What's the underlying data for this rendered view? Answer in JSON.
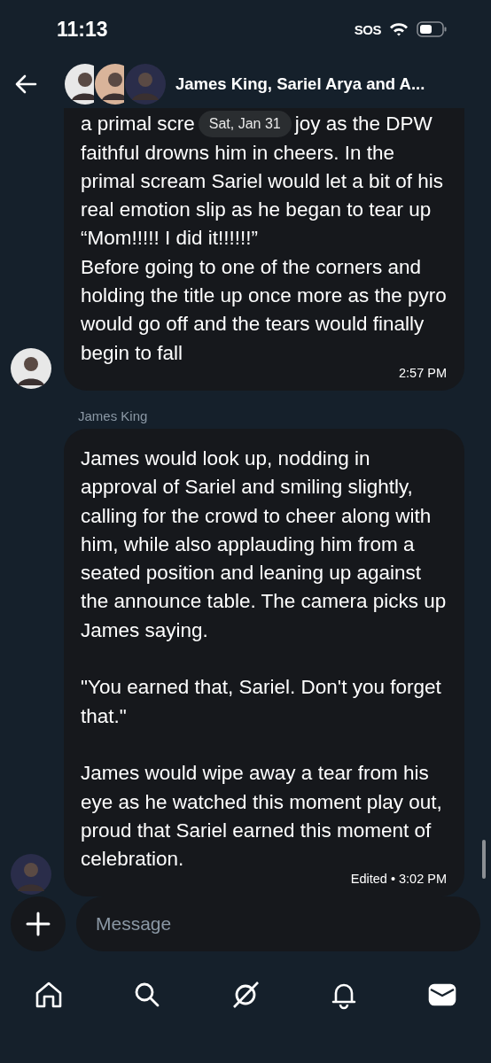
{
  "status_bar": {
    "time": "11:13",
    "sos": "SOS"
  },
  "header": {
    "title": "James King, Sariel Arya and A..."
  },
  "messages": [
    {
      "first_line": [
        "a primal scre",
        "joy as the DPW"
      ],
      "date_pill": "Sat, Jan 31",
      "text": "faithful drowns him in cheers. In the primal scream Sariel would let a bit of his real emotion slip as he began to tear up “Mom!!!!! I did it!!!!!!”\nBefore going to one of the corners and holding the title up once more as the pyro would go off and the tears would finally begin to fall",
      "time": "2:57 PM"
    },
    {
      "sender": "James King",
      "text": "James would look up, nodding in approval of Sariel and smiling slightly, calling for the crowd to cheer along with him, while also applauding him from a seated position and leaning up against the announce table. The camera picks up James saying.\n\n\"You earned that, Sariel. Don't you forget that.\"\n\nJames would wipe away a tear from his eye as he watched this moment play out, proud that Sariel earned this moment of celebration.",
      "time": "Edited • 3:02 PM"
    }
  ],
  "composer": {
    "placeholder": "Message"
  },
  "nav": [
    {
      "kind": "home",
      "selected": false
    },
    {
      "kind": "search",
      "selected": false
    },
    {
      "kind": "grok",
      "selected": false
    },
    {
      "kind": "bell",
      "selected": false
    },
    {
      "kind": "mail",
      "selected": true
    }
  ]
}
